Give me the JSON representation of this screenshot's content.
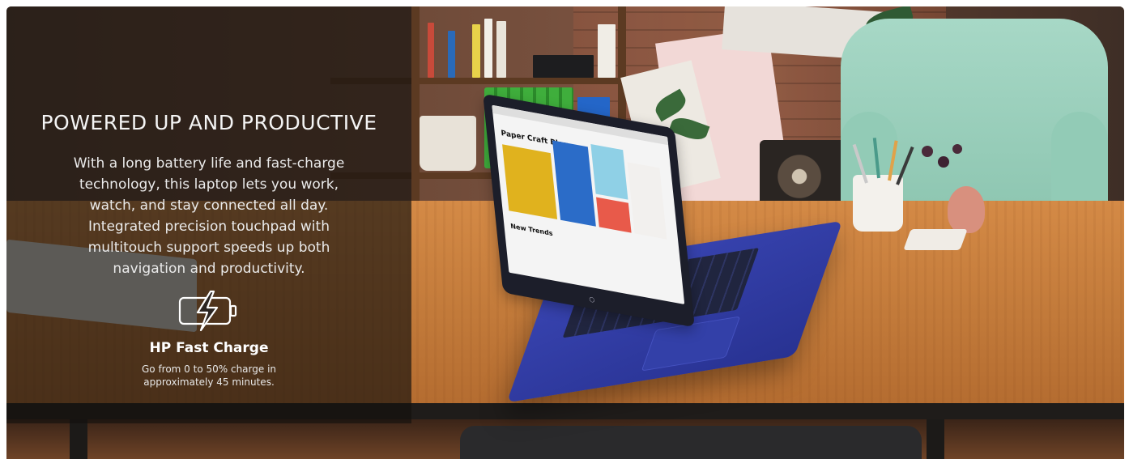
{
  "headline": "POWERED UP AND PRODUCTIVE",
  "body": "With a long battery life and fast-charge technology, this laptop lets you work, watch, and stay connected all day. Integrated precision touchpad with multitouch support speeds up both navigation and productivity.",
  "feature": {
    "icon": "battery-fast-charge-icon",
    "title": "HP Fast Charge",
    "description_line1": "Go from 0 to 50% charge in",
    "description_line2": "approximately 45 minutes."
  },
  "laptop_screen": {
    "site_title": "Paper Craft Blog",
    "headline_tile": "New Trends"
  },
  "colors": {
    "panel_overlay": "#14100e",
    "laptop_blue": "#3340a8",
    "table_wood": "#c27a3a"
  }
}
